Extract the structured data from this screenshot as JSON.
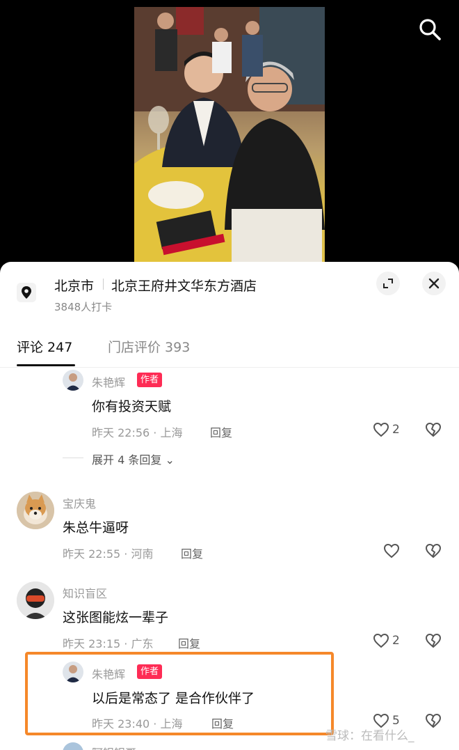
{
  "header": {
    "search_icon": "search-icon"
  },
  "location": {
    "city": "北京市",
    "name": "北京王府井文华东方酒店",
    "checkins": "3848人打卡",
    "icons": {
      "pin": "location-pin-icon",
      "expand": "expand-icon",
      "close": "close-icon"
    }
  },
  "tabs": [
    {
      "label": "评论 247",
      "active": true
    },
    {
      "label": "门店评价 393",
      "active": false
    }
  ],
  "comments": [
    {
      "name": "朱艳辉",
      "badge": "作者",
      "text": "你有投资天赋",
      "time": "昨天 22:56 · 上海",
      "reply": "回复",
      "likes": "2",
      "more": "展开 4 条回复"
    },
    {
      "name": "宝庆鬼",
      "text": "朱总牛逼呀",
      "time": "昨天 22:55 · 河南",
      "reply": "回复",
      "likes": ""
    },
    {
      "name": "知识盲区",
      "text": "这张图能炫一辈子",
      "time": "昨天 23:15 · 广东",
      "reply": "回复",
      "likes": "2"
    },
    {
      "name": "朱艳辉",
      "badge": "作者",
      "text": "以后是常态了 是合作伙伴了",
      "time": "昨天 23:40 · 上海",
      "reply": "回复",
      "likes": "5"
    },
    {
      "name": "阿银银哥"
    }
  ],
  "watermark": "雪球：在看什么_",
  "colors": {
    "author_badge": "#fe2c55",
    "highlight": "#f5882a"
  }
}
